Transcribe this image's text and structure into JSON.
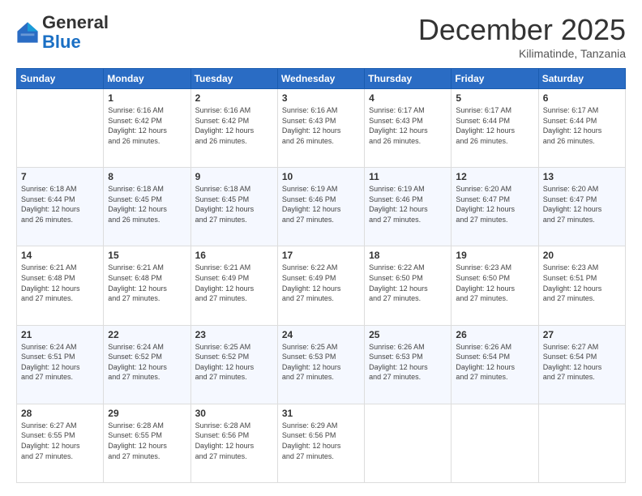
{
  "header": {
    "logo_general": "General",
    "logo_blue": "Blue",
    "month_year": "December 2025",
    "location": "Kilimatinde, Tanzania"
  },
  "weekdays": [
    "Sunday",
    "Monday",
    "Tuesday",
    "Wednesday",
    "Thursday",
    "Friday",
    "Saturday"
  ],
  "weeks": [
    [
      {
        "day": "",
        "info": ""
      },
      {
        "day": "1",
        "info": "Sunrise: 6:16 AM\nSunset: 6:42 PM\nDaylight: 12 hours\nand 26 minutes."
      },
      {
        "day": "2",
        "info": "Sunrise: 6:16 AM\nSunset: 6:42 PM\nDaylight: 12 hours\nand 26 minutes."
      },
      {
        "day": "3",
        "info": "Sunrise: 6:16 AM\nSunset: 6:43 PM\nDaylight: 12 hours\nand 26 minutes."
      },
      {
        "day": "4",
        "info": "Sunrise: 6:17 AM\nSunset: 6:43 PM\nDaylight: 12 hours\nand 26 minutes."
      },
      {
        "day": "5",
        "info": "Sunrise: 6:17 AM\nSunset: 6:44 PM\nDaylight: 12 hours\nand 26 minutes."
      },
      {
        "day": "6",
        "info": "Sunrise: 6:17 AM\nSunset: 6:44 PM\nDaylight: 12 hours\nand 26 minutes."
      }
    ],
    [
      {
        "day": "7",
        "info": "Sunrise: 6:18 AM\nSunset: 6:44 PM\nDaylight: 12 hours\nand 26 minutes."
      },
      {
        "day": "8",
        "info": "Sunrise: 6:18 AM\nSunset: 6:45 PM\nDaylight: 12 hours\nand 26 minutes."
      },
      {
        "day": "9",
        "info": "Sunrise: 6:18 AM\nSunset: 6:45 PM\nDaylight: 12 hours\nand 27 minutes."
      },
      {
        "day": "10",
        "info": "Sunrise: 6:19 AM\nSunset: 6:46 PM\nDaylight: 12 hours\nand 27 minutes."
      },
      {
        "day": "11",
        "info": "Sunrise: 6:19 AM\nSunset: 6:46 PM\nDaylight: 12 hours\nand 27 minutes."
      },
      {
        "day": "12",
        "info": "Sunrise: 6:20 AM\nSunset: 6:47 PM\nDaylight: 12 hours\nand 27 minutes."
      },
      {
        "day": "13",
        "info": "Sunrise: 6:20 AM\nSunset: 6:47 PM\nDaylight: 12 hours\nand 27 minutes."
      }
    ],
    [
      {
        "day": "14",
        "info": "Sunrise: 6:21 AM\nSunset: 6:48 PM\nDaylight: 12 hours\nand 27 minutes."
      },
      {
        "day": "15",
        "info": "Sunrise: 6:21 AM\nSunset: 6:48 PM\nDaylight: 12 hours\nand 27 minutes."
      },
      {
        "day": "16",
        "info": "Sunrise: 6:21 AM\nSunset: 6:49 PM\nDaylight: 12 hours\nand 27 minutes."
      },
      {
        "day": "17",
        "info": "Sunrise: 6:22 AM\nSunset: 6:49 PM\nDaylight: 12 hours\nand 27 minutes."
      },
      {
        "day": "18",
        "info": "Sunrise: 6:22 AM\nSunset: 6:50 PM\nDaylight: 12 hours\nand 27 minutes."
      },
      {
        "day": "19",
        "info": "Sunrise: 6:23 AM\nSunset: 6:50 PM\nDaylight: 12 hours\nand 27 minutes."
      },
      {
        "day": "20",
        "info": "Sunrise: 6:23 AM\nSunset: 6:51 PM\nDaylight: 12 hours\nand 27 minutes."
      }
    ],
    [
      {
        "day": "21",
        "info": "Sunrise: 6:24 AM\nSunset: 6:51 PM\nDaylight: 12 hours\nand 27 minutes."
      },
      {
        "day": "22",
        "info": "Sunrise: 6:24 AM\nSunset: 6:52 PM\nDaylight: 12 hours\nand 27 minutes."
      },
      {
        "day": "23",
        "info": "Sunrise: 6:25 AM\nSunset: 6:52 PM\nDaylight: 12 hours\nand 27 minutes."
      },
      {
        "day": "24",
        "info": "Sunrise: 6:25 AM\nSunset: 6:53 PM\nDaylight: 12 hours\nand 27 minutes."
      },
      {
        "day": "25",
        "info": "Sunrise: 6:26 AM\nSunset: 6:53 PM\nDaylight: 12 hours\nand 27 minutes."
      },
      {
        "day": "26",
        "info": "Sunrise: 6:26 AM\nSunset: 6:54 PM\nDaylight: 12 hours\nand 27 minutes."
      },
      {
        "day": "27",
        "info": "Sunrise: 6:27 AM\nSunset: 6:54 PM\nDaylight: 12 hours\nand 27 minutes."
      }
    ],
    [
      {
        "day": "28",
        "info": "Sunrise: 6:27 AM\nSunset: 6:55 PM\nDaylight: 12 hours\nand 27 minutes."
      },
      {
        "day": "29",
        "info": "Sunrise: 6:28 AM\nSunset: 6:55 PM\nDaylight: 12 hours\nand 27 minutes."
      },
      {
        "day": "30",
        "info": "Sunrise: 6:28 AM\nSunset: 6:56 PM\nDaylight: 12 hours\nand 27 minutes."
      },
      {
        "day": "31",
        "info": "Sunrise: 6:29 AM\nSunset: 6:56 PM\nDaylight: 12 hours\nand 27 minutes."
      },
      {
        "day": "",
        "info": ""
      },
      {
        "day": "",
        "info": ""
      },
      {
        "day": "",
        "info": ""
      }
    ]
  ]
}
